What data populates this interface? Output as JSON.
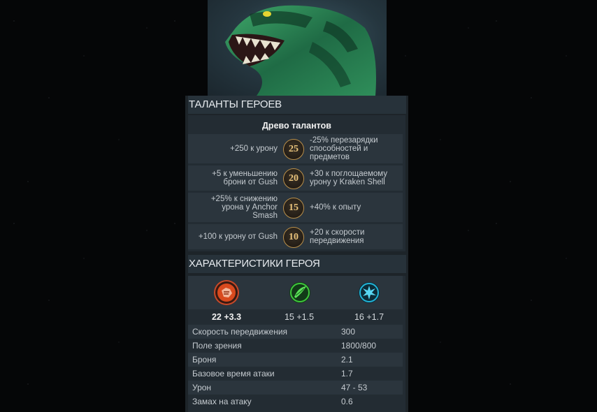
{
  "talents_section": {
    "title": "ТАЛАНТЫ ГЕРОЕВ",
    "tree_title": "Древо талантов",
    "rows": [
      {
        "level": "25",
        "left": "+250 к урону",
        "right": "-25% перезарядки способностей и предметов"
      },
      {
        "level": "20",
        "left": "+5 к уменьшению брони от Gush",
        "right": "+30 к поглощаемому урону у Kraken Shell"
      },
      {
        "level": "15",
        "left": "+25% к снижению урона у Anchor Smash",
        "right": "+40% к опыту"
      },
      {
        "level": "10",
        "left": "+100 к урону от Gush",
        "right": "+20 к скорости передвижения"
      }
    ]
  },
  "stats_section": {
    "title": "ХАРАКТЕРИСТИКИ ГЕРОЯ",
    "attributes": {
      "strength": {
        "icon": "strength-icon",
        "value": "22 +3.3",
        "color": "#d94a1e"
      },
      "agility": {
        "icon": "agility-icon",
        "value": "15 +1.5",
        "color": "#3fc63c"
      },
      "intelligence": {
        "icon": "intelligence-icon",
        "value": "16 +1.7",
        "color": "#22b3d6"
      }
    },
    "rows": [
      {
        "label": "Скорость передвижения",
        "value": "300"
      },
      {
        "label": "Поле зрения",
        "value": "1800/800"
      },
      {
        "label": "Броня",
        "value": "2.1"
      },
      {
        "label": "Базовое время атаки",
        "value": "1.7"
      },
      {
        "label": "Урон",
        "value": "47 - 53"
      },
      {
        "label": "Замах на атаку",
        "value": "0.6"
      }
    ]
  }
}
